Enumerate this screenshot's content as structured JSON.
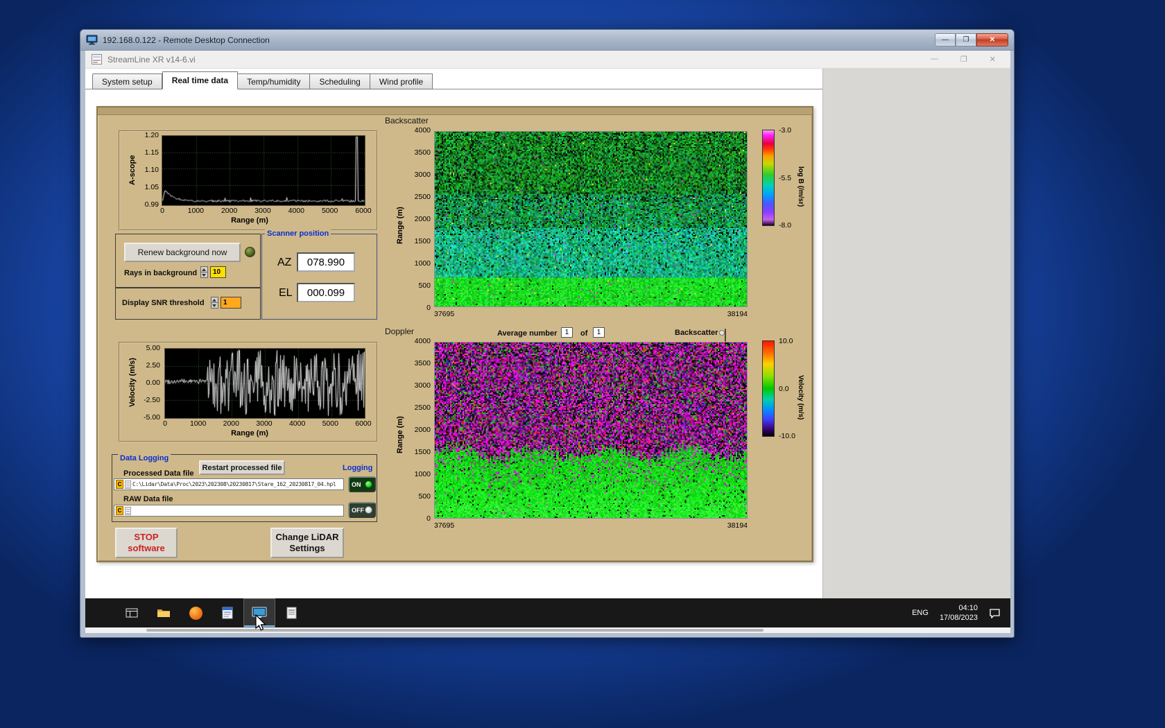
{
  "rdp_window": {
    "title": "192.168.0.122 - Remote Desktop Connection",
    "min_glyph": "—",
    "max_glyph": "❐",
    "close_glyph": "✕"
  },
  "app_window": {
    "title": "StreamLine XR v14-6.vi",
    "min_glyph": "—",
    "restore_glyph": "❐",
    "close_glyph": "✕",
    "tabs": [
      "System setup",
      "Real time data",
      "Temp/humidity",
      "Scheduling",
      "Wind profile"
    ],
    "active_tab_index": 1
  },
  "controls": {
    "renew_button_label": "Renew background now",
    "rays_in_background_label": "Rays in background",
    "rays_in_background_value": "10",
    "display_snr_threshold_label": "Display SNR threshold",
    "display_snr_threshold_value": "1",
    "scanner_position": {
      "title": "Scanner position",
      "az_label": "AZ",
      "az_value": "078.990",
      "el_label": "EL",
      "el_value": "000.099"
    },
    "average_number_label": "Average number",
    "average_number_value": "1",
    "of_label": "of",
    "of_value": "1",
    "backscatter_switch_label": "Backscatter",
    "stop_button": {
      "line1": "STOP",
      "line2": "software"
    },
    "change_lidar_button": {
      "line1": "Change LiDAR",
      "line2": "Settings"
    }
  },
  "data_logging": {
    "group_title": "Data Logging",
    "processed_file_label": "Processed Data file",
    "restart_button_label": "Restart processed file",
    "logging_label": "Logging",
    "drive_badge": "C",
    "processed_file_path": "C:\\Lidar\\Data\\Proc\\2023\\202308\\20230817\\Stare_162_20230817_04.hpl",
    "processed_logging_state": "ON",
    "raw_file_label": "RAW Data file",
    "raw_file_path": "",
    "raw_logging_state": "OFF"
  },
  "taskbar": {
    "language": "ENG",
    "time": "04:10",
    "date": "17/08/2023"
  },
  "colors": {
    "panel_tan": "#cfb98a",
    "group_label_blue": "#0a2fd0",
    "stop_text_red": "#cc2222",
    "led_on_green": "#39e639",
    "taskbar_dark": "#181818"
  },
  "chart_data": [
    {
      "id": "a_scope",
      "type": "line",
      "ylabel": "A-scope",
      "xlabel": "Range (m)",
      "xlim": [
        0,
        6000
      ],
      "ylim": [
        0.99,
        1.2
      ],
      "xticks": [
        "0",
        "1000",
        "2000",
        "3000",
        "4000",
        "5000",
        "6000"
      ],
      "yticks": [
        "1.20",
        "1.15",
        "1.10",
        "1.05",
        "0.99"
      ],
      "grid": true,
      "series": [
        {
          "name": "a-scope-trace",
          "summary": "flat baseline near 1.00 with an initial bump to about 1.04 below 500 m and one narrow full-height spike to 1.20 near 5800 m"
        }
      ]
    },
    {
      "id": "velocity_scope",
      "type": "line",
      "ylabel": "Velocity (m/s)",
      "xlabel": "Range (m)",
      "xlim": [
        0,
        6000
      ],
      "ylim": [
        -5,
        5
      ],
      "xticks": [
        "0",
        "1000",
        "2000",
        "3000",
        "4000",
        "5000",
        "6000"
      ],
      "yticks": [
        "5.00",
        "2.50",
        "0.00",
        "-2.50",
        "-5.00"
      ],
      "grid": true,
      "series": [
        {
          "name": "velocity-trace",
          "summary": "near 0 m/s out to about 1200 m, then saturated random noise spanning the full ±5 m/s range to 6000 m"
        }
      ]
    },
    {
      "id": "backscatter_heatmap",
      "type": "heatmap",
      "title": "Backscatter",
      "ylabel": "Range (m)",
      "yticks": [
        "4000",
        "3500",
        "3000",
        "2500",
        "2000",
        "1500",
        "1000",
        "500",
        "0"
      ],
      "xticks": [
        "37695",
        "38194"
      ],
      "xlim": [
        37695,
        38194
      ],
      "ylim": [
        0,
        4000
      ],
      "colorbar": {
        "label": "log B (/m/sr)",
        "ticks": [
          "-3.0",
          "-5.5",
          "-8.0"
        ],
        "range": [
          -3.0,
          -8.0
        ]
      },
      "summary": "bright green/cyan backscatter below about 2000 m fading into speckled green/black noise aloft"
    },
    {
      "id": "doppler_heatmap",
      "type": "heatmap",
      "title": "Doppler",
      "ylabel": "Range (m)",
      "yticks": [
        "4000",
        "3500",
        "3000",
        "2500",
        "2000",
        "1500",
        "1000",
        "500",
        "0"
      ],
      "xticks": [
        "37695",
        "38194"
      ],
      "xlim": [
        37695,
        38194
      ],
      "ylim": [
        0,
        4000
      ],
      "colorbar": {
        "label": "Velocity (m/s)",
        "ticks": [
          "10.0",
          "0.0",
          "-10.0"
        ],
        "range": [
          10.0,
          -10.0
        ]
      },
      "summary": "coherent near-zero velocities (green) below about 1500 m with uncorrelated magenta/black noise above"
    }
  ]
}
